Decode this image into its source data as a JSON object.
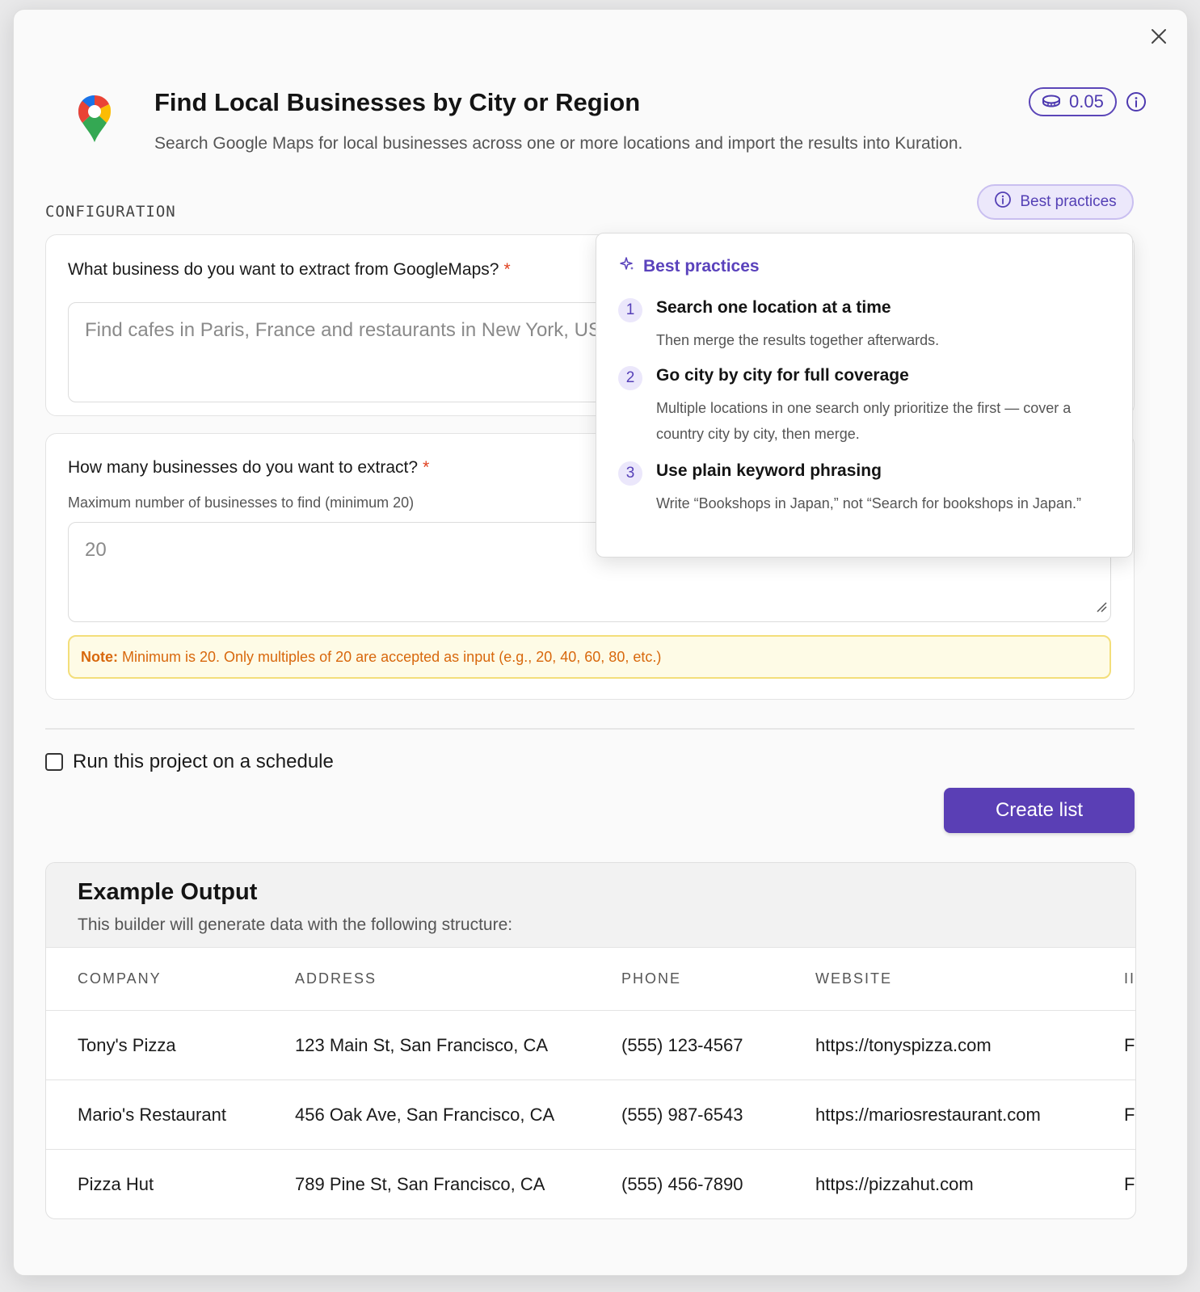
{
  "header": {
    "title": "Find Local Businesses by City or Region",
    "subtitle": "Search Google Maps for local businesses across one or more locations and import the results into Kuration.",
    "credits": "0.05",
    "icon": "google-maps-pin-icon"
  },
  "config": {
    "section_label": "CONFIGURATION",
    "best_practices_button": "Best practices"
  },
  "question1": {
    "label": "What business do you want to extract from GoogleMaps?",
    "required_mark": "*",
    "placeholder": "Find cafes in Paris, France and restaurants in New York, USA"
  },
  "question2": {
    "label": "How many businesses do you want to extract?",
    "required_mark": "*",
    "help": "Maximum number of businesses to find (minimum 20)",
    "placeholder": "20",
    "note_prefix": "Note:",
    "note_text": "Minimum is 20. Only multiples of 20 are accepted as input (e.g., 20, 40, 60, 80, etc.)"
  },
  "schedule": {
    "label": "Run this project on a schedule",
    "checked": false
  },
  "actions": {
    "create_label": "Create list"
  },
  "popover": {
    "title": "Best practices",
    "items": [
      {
        "num": "1",
        "title": "Search one location at a time",
        "desc": "Then merge the results together afterwards."
      },
      {
        "num": "2",
        "title": "Go city by city for full coverage",
        "desc": "Multiple locations in one search only prioritize the first — cover a country city by city, then merge."
      },
      {
        "num": "3",
        "title": "Use plain keyword phrasing",
        "desc": "Write “Bookshops in Japan,” not “Search for bookshops in Japan.”"
      }
    ]
  },
  "example": {
    "title": "Example Output",
    "subtitle": "This builder will generate data with the following structure:",
    "columns": [
      "COMPANY",
      "ADDRESS",
      "PHONE",
      "WEBSITE",
      "II"
    ],
    "rows": [
      [
        "Tony's Pizza",
        "123 Main St, San Francisco, CA",
        "(555) 123-4567",
        "https://tonyspizza.com",
        "F"
      ],
      [
        "Mario's Restaurant",
        "456 Oak Ave, San Francisco, CA",
        "(555) 987-6543",
        "https://mariosrestaurant.com",
        "F"
      ],
      [
        "Pizza Hut",
        "789 Pine St, San Francisco, CA",
        "(555) 456-7890",
        "https://pizzahut.com",
        "F"
      ]
    ]
  },
  "colors": {
    "accent": "#5a3fb5",
    "note_text": "#d8680d",
    "note_bg": "#fefbe6",
    "required": "#e0401f"
  }
}
